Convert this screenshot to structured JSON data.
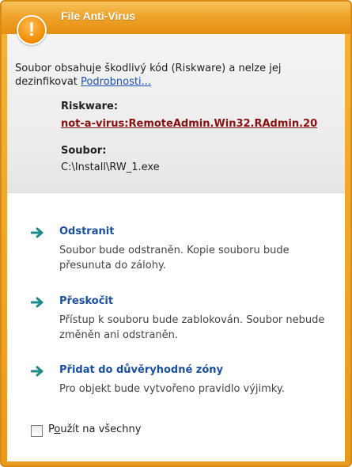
{
  "window": {
    "title": "File Anti-Virus"
  },
  "message": {
    "text": "Soubor obsahuje škodlivý kód (Riskware) a nelze jej dezinfikovat",
    "link": "Podrobnosti..."
  },
  "details": {
    "riskware_label": "Riskware:",
    "riskware_value": "not-a-virus:RemoteAdmin.Win32.RAdmin.20",
    "file_label": "Soubor:",
    "file_value": "C:\\Install\\RW_1.exe"
  },
  "options": [
    {
      "title": "Odstranit",
      "description": "Soubor bude odstraněn. Kopie souboru bude přesunuta do zálohy."
    },
    {
      "title": "Přeskočit",
      "description": "Přístup k souboru bude zablokován. Soubor nebude změněn ani odstraněn."
    },
    {
      "title": "Přidat do důvěryhodné zóny",
      "description": "Pro objekt bude vytvořeno pravidlo výjimky."
    }
  ],
  "apply_all": {
    "label_first": "P",
    "label_underlined": "o",
    "label_rest": "užít na všechny",
    "checked": false
  },
  "colors": {
    "accent_orange": "#e89a1e",
    "link_blue": "#1c4fb4",
    "threat_red": "#8a1010",
    "action_teal": "#1e8a8a"
  }
}
